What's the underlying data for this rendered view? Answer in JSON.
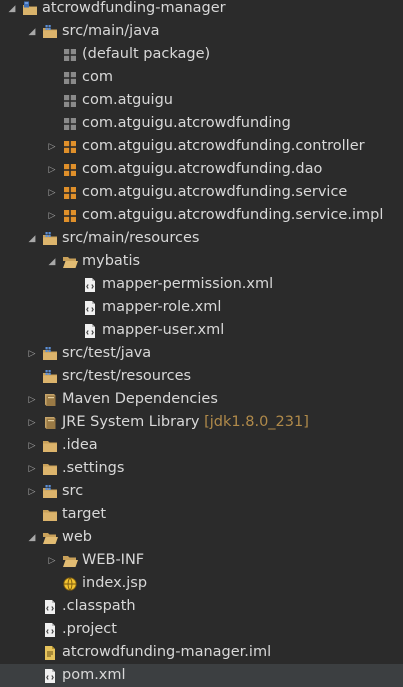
{
  "tree": [
    {
      "label": "atcrowdfunding-manager",
      "icon": "project-folder-icon",
      "indent": 0,
      "toggle": "expanded"
    },
    {
      "label": "src/main/java",
      "icon": "source-folder-icon",
      "indent": 1,
      "toggle": "expanded"
    },
    {
      "label": "(default package)",
      "icon": "package-icon",
      "indent": 2,
      "toggle": "none"
    },
    {
      "label": "com",
      "icon": "package-icon",
      "indent": 2,
      "toggle": "none"
    },
    {
      "label": "com.atguigu",
      "icon": "package-icon",
      "indent": 2,
      "toggle": "none"
    },
    {
      "label": "com.atguigu.atcrowdfunding",
      "icon": "package-icon",
      "indent": 2,
      "toggle": "none"
    },
    {
      "label": "com.atguigu.atcrowdfunding.controller",
      "icon": "package-content-icon",
      "indent": 2,
      "toggle": "collapsed"
    },
    {
      "label": "com.atguigu.atcrowdfunding.dao",
      "icon": "package-content-icon",
      "indent": 2,
      "toggle": "collapsed"
    },
    {
      "label": "com.atguigu.atcrowdfunding.service",
      "icon": "package-content-icon",
      "indent": 2,
      "toggle": "collapsed"
    },
    {
      "label": "com.atguigu.atcrowdfunding.service.impl",
      "icon": "package-content-icon",
      "indent": 2,
      "toggle": "collapsed"
    },
    {
      "label": "src/main/resources",
      "icon": "source-folder-icon",
      "indent": 1,
      "toggle": "expanded"
    },
    {
      "label": "mybatis",
      "icon": "folder-open-icon",
      "indent": 2,
      "toggle": "expanded"
    },
    {
      "label": "mapper-permission.xml",
      "icon": "xml-file-icon",
      "indent": 3,
      "toggle": "none"
    },
    {
      "label": "mapper-role.xml",
      "icon": "xml-file-icon",
      "indent": 3,
      "toggle": "none"
    },
    {
      "label": "mapper-user.xml",
      "icon": "xml-file-icon",
      "indent": 3,
      "toggle": "none"
    },
    {
      "label": "src/test/java",
      "icon": "source-folder-icon",
      "indent": 1,
      "toggle": "collapsed"
    },
    {
      "label": "src/test/resources",
      "icon": "source-folder-icon",
      "indent": 1,
      "toggle": "none"
    },
    {
      "label": "Maven Dependencies",
      "icon": "library-icon",
      "indent": 1,
      "toggle": "collapsed"
    },
    {
      "label": "JRE System Library",
      "decoration": "[jdk1.8.0_231]",
      "icon": "library-icon",
      "indent": 1,
      "toggle": "collapsed"
    },
    {
      "label": ".idea",
      "icon": "folder-icon",
      "indent": 1,
      "toggle": "collapsed"
    },
    {
      "label": ".settings",
      "icon": "folder-icon",
      "indent": 1,
      "toggle": "collapsed"
    },
    {
      "label": "src",
      "icon": "source-folder-icon",
      "indent": 1,
      "toggle": "collapsed"
    },
    {
      "label": "target",
      "icon": "folder-icon",
      "indent": 1,
      "toggle": "none"
    },
    {
      "label": "web",
      "icon": "folder-open-icon",
      "indent": 1,
      "toggle": "expanded"
    },
    {
      "label": "WEB-INF",
      "icon": "folder-open-icon",
      "indent": 2,
      "toggle": "collapsed"
    },
    {
      "label": "index.jsp",
      "icon": "jsp-file-icon",
      "indent": 2,
      "toggle": "none"
    },
    {
      "label": ".classpath",
      "icon": "xml-file-icon",
      "indent": 1,
      "toggle": "none"
    },
    {
      "label": ".project",
      "icon": "xml-file-icon",
      "indent": 1,
      "toggle": "none"
    },
    {
      "label": "atcrowdfunding-manager.iml",
      "icon": "text-file-icon",
      "indent": 1,
      "toggle": "none"
    },
    {
      "label": "pom.xml",
      "icon": "xml-file-icon",
      "indent": 1,
      "toggle": "none",
      "selected": true
    }
  ]
}
